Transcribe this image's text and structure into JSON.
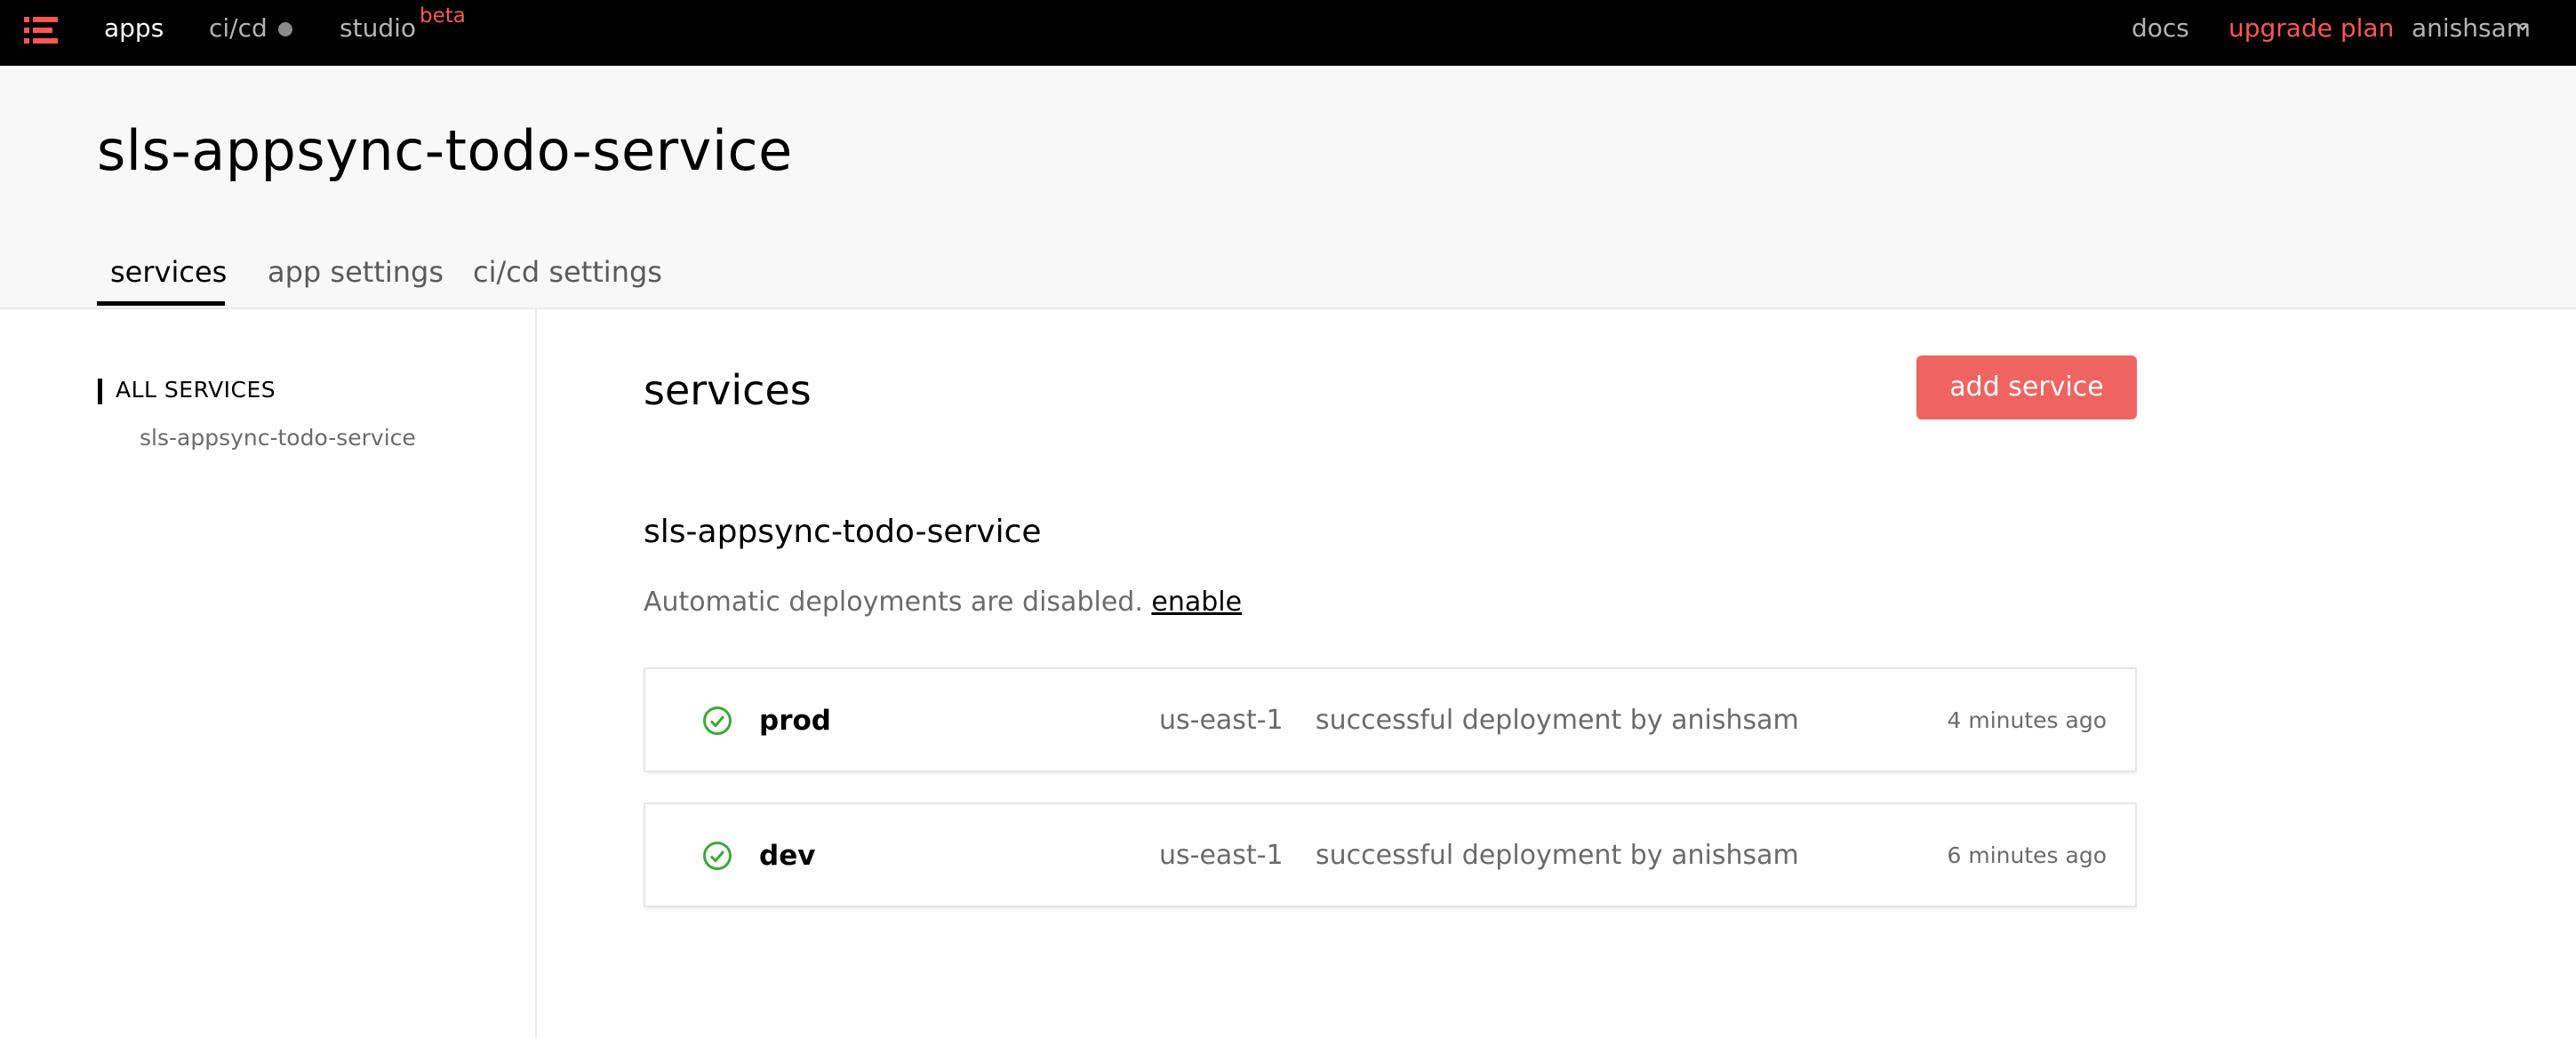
{
  "topnav": {
    "apps": "apps",
    "cicd": "ci/cd",
    "studio": "studio",
    "beta": "beta",
    "docs": "docs",
    "upgrade": "upgrade plan",
    "user": "anishsam"
  },
  "app": {
    "title": "sls-appsync-todo-service"
  },
  "tabs": {
    "services": "services",
    "app_settings": "app settings",
    "cicd_settings": "ci/cd settings"
  },
  "sidebar": {
    "heading": "ALL SERVICES",
    "items": [
      "sls-appsync-todo-service"
    ]
  },
  "main": {
    "title": "services",
    "add_button": "add service",
    "service_name": "sls-appsync-todo-service",
    "auto_deploy_text": "Automatic deployments are disabled.",
    "enable_link": "enable",
    "stages": [
      {
        "name": "prod",
        "region": "us-east-1",
        "status": "successful deployment by anishsam",
        "time": "4 minutes ago"
      },
      {
        "name": "dev",
        "region": "us-east-1",
        "status": "successful deployment by anishsam",
        "time": "6 minutes ago"
      }
    ]
  },
  "colors": {
    "accent": "#fd5750",
    "button": "#ef6460",
    "success": "#3aa935",
    "nav_bg": "#000000",
    "header_bg": "#f8f8f8"
  },
  "icons": {
    "logo": "serverless-logo-icon",
    "status": "status-dot-icon",
    "user_menu": "chevron-down-icon",
    "stage_status": "check-circle-icon"
  }
}
